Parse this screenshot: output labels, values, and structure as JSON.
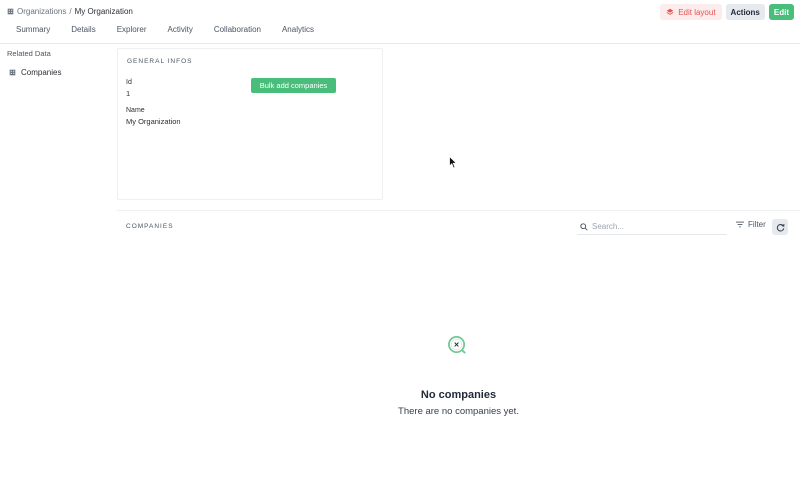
{
  "header": {
    "breadcrumb": {
      "parent": "Organizations",
      "separator": "/",
      "current": "My Organization"
    },
    "tabs": [
      "Summary",
      "Details",
      "Explorer",
      "Activity",
      "Collaboration",
      "Analytics"
    ],
    "actions": {
      "edit_layout": "Edit layout",
      "actions": "Actions",
      "edit": "Edit"
    }
  },
  "sidebar": {
    "title": "Related Data",
    "items": [
      {
        "label": "Companies",
        "icon": "building-icon"
      }
    ]
  },
  "general": {
    "title": "GENERAL INFOS",
    "fields": [
      {
        "label": "Id",
        "value": "1"
      },
      {
        "label": "Name",
        "value": "My Organization"
      }
    ],
    "bulk_button": "Bulk add companies"
  },
  "companies": {
    "title": "COMPANIES",
    "search_placeholder": "Search...",
    "filter_label": "Filter",
    "empty_title": "No companies",
    "empty_subtitle": "There are no companies yet."
  },
  "colors": {
    "accent_green": "#49bd7a",
    "edit_layout_bg": "#fdecec",
    "edit_layout_text": "#e55353",
    "neutral_button": "#e6e9ee"
  }
}
